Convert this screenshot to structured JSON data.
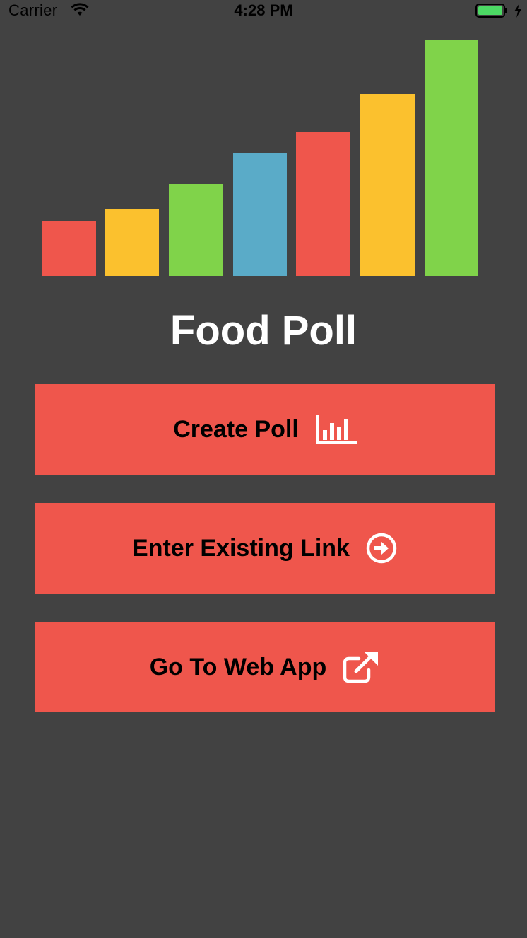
{
  "status_bar": {
    "carrier": "Carrier",
    "time": "4:28 PM",
    "battery_color": "#4cd964"
  },
  "logo_chart": {
    "bars": [
      {
        "level": 0.23,
        "color": "#ef564c"
      },
      {
        "level": 0.28,
        "color": "#fbc12e"
      },
      {
        "level": 0.39,
        "color": "#80d34a"
      },
      {
        "level": 0.52,
        "color": "#5aabc8"
      },
      {
        "level": 0.61,
        "color": "#ef564c"
      },
      {
        "level": 0.77,
        "color": "#fbc12e"
      },
      {
        "level": 1.0,
        "color": "#80d34a"
      }
    ]
  },
  "title": "Food Poll",
  "buttons": {
    "create": {
      "label": "Create Poll",
      "icon": "bar-chart-icon"
    },
    "enter": {
      "label": "Enter Existing Link",
      "icon": "arrow-circle-right-icon"
    },
    "web": {
      "label": "Go To Web App",
      "icon": "external-link-icon"
    }
  },
  "colors": {
    "background": "#424242",
    "button": "#ef564c",
    "title": "#ffffff"
  }
}
